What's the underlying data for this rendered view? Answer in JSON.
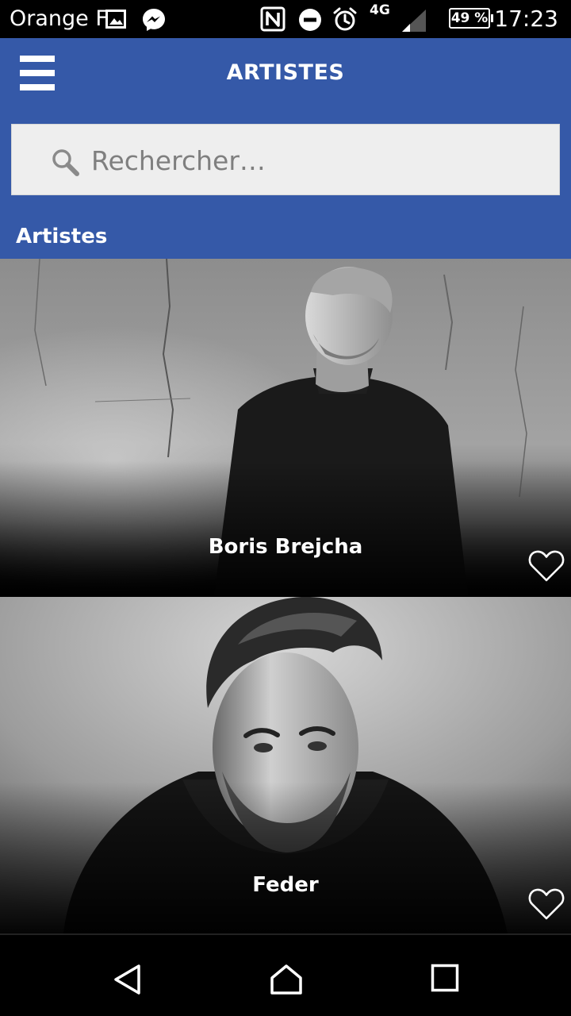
{
  "status_bar": {
    "carrier": "Orange F",
    "network_type": "4G",
    "battery": "49 %",
    "time": "17:23",
    "icons": [
      "gallery-icon",
      "messenger-icon",
      "nfc-icon",
      "do-not-disturb-icon",
      "alarm-icon",
      "signal-icon",
      "battery-icon"
    ]
  },
  "header": {
    "title": "ARTISTES",
    "menu_icon": "hamburger-menu-icon"
  },
  "search": {
    "placeholder": "Rechercher…",
    "value": "",
    "icon": "search-icon"
  },
  "section": {
    "heading": "Artistes"
  },
  "artists": [
    {
      "name": "Boris Brejcha",
      "favorite": false,
      "favorite_icon": "heart-outline-icon"
    },
    {
      "name": "Feder",
      "favorite": false,
      "favorite_icon": "heart-outline-icon"
    }
  ],
  "nav_bar": {
    "buttons": [
      "back-icon",
      "home-icon",
      "recents-icon"
    ]
  },
  "colors": {
    "header_blue": "#3559a8",
    "search_bg": "#eeeeee",
    "placeholder_gray": "#7f7f7f"
  }
}
